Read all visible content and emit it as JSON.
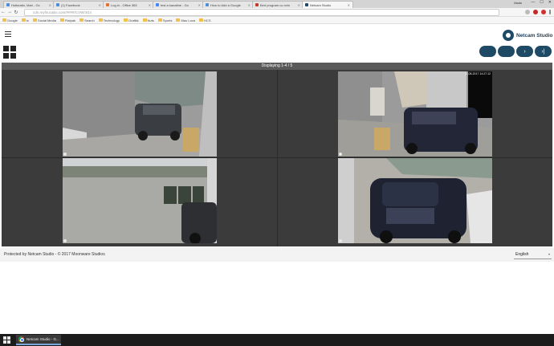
{
  "browser": {
    "tabs": [
      {
        "label": "Hotkeatin, Mari - Gc"
      },
      {
        "label": "(1) Facebook"
      },
      {
        "label": "Log in - Office 365"
      },
      {
        "label": "test a kanaltne - Go"
      },
      {
        "label": "How to Add a Google"
      },
      {
        "label": "Bed program uu nvin"
      },
      {
        "label": "Netcam Studio",
        "active": true
      }
    ],
    "user": "Mads",
    "window_controls": [
      "—",
      "☐",
      "✕"
    ],
    "address": "cdn.myfnucabo.com/####/CVW/4G4",
    "bookmarks": [
      "Google",
      "tv",
      "Social Media",
      "Flatpak",
      "Search",
      "Technology",
      "Grafikk",
      "Nuts",
      "Sports",
      "Mao Loca",
      "HCS"
    ]
  },
  "app": {
    "logo_text": "Netcam Studio",
    "pager": {
      "buttons": [
        {
          "name": "first-page",
          "label": ""
        },
        {
          "name": "prev-page",
          "label": ""
        },
        {
          "name": "next-page",
          "label": "›"
        },
        {
          "name": "last-page",
          "label": "›|"
        }
      ]
    },
    "grid_header": "Displaying 1-4 / 5",
    "cameras": [
      {
        "timestamp": ""
      },
      {
        "timestamp": "11-08-2017 14:27:12"
      },
      {
        "timestamp": ""
      },
      {
        "timestamp": ""
      }
    ],
    "footer": {
      "copyright": "Protected by Netcam Studio - © 2017 Moonware Studios",
      "language": "English"
    }
  },
  "taskbar": {
    "task_label": "Netcam Studio - G..."
  }
}
